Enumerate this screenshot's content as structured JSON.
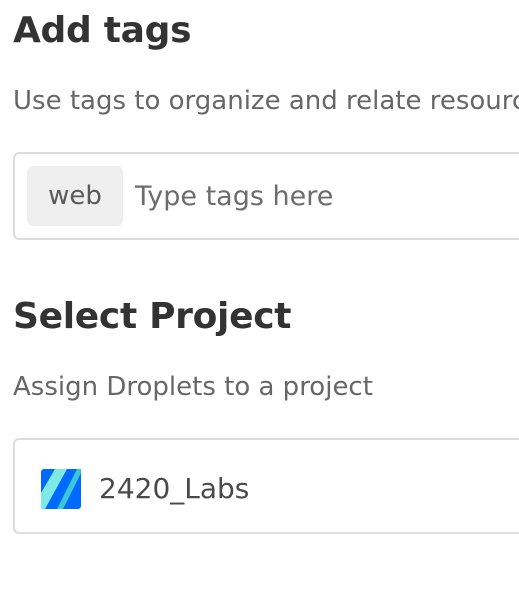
{
  "tags": {
    "title": "Add tags",
    "description": "Use tags to organize and relate resources",
    "chips": [
      "web"
    ],
    "input_placeholder": "Type tags here",
    "input_value": ""
  },
  "project": {
    "title": "Select Project",
    "description": "Assign Droplets to a project",
    "selected_name": "2420_Labs",
    "icon": "project-stripes-icon",
    "icon_colors": {
      "dark_blue": "#0069ff",
      "light_cyan": "#7fe9e6",
      "mid_cyan": "#39c7d8"
    }
  }
}
